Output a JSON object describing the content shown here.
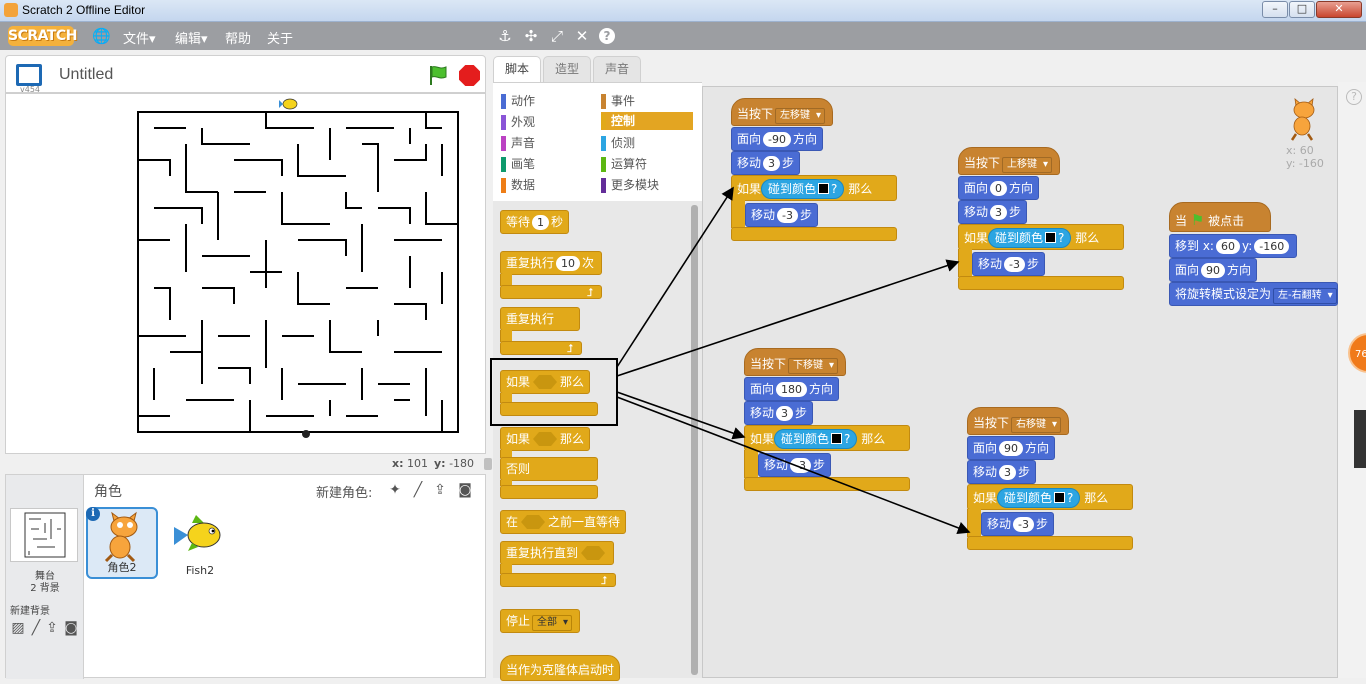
{
  "window": {
    "title": "Scratch 2 Offline Editor",
    "buttons": [
      "–",
      "□",
      "✕"
    ]
  },
  "menubar": {
    "logo": "SCRATCH",
    "items": [
      "文件▾",
      "编辑▾",
      "帮助",
      "关于"
    ],
    "tools": [
      "stamp-icon",
      "cut-icon",
      "grow-icon",
      "shrink-icon",
      "help-icon"
    ]
  },
  "stage": {
    "version": "v454",
    "title": "Untitled",
    "x_label": "x:",
    "x_value": "101",
    "y_label": "y:",
    "y_value": "-180"
  },
  "sprites_pane": {
    "title": "角色",
    "new_sprite": "新建角色:",
    "stage_name": "舞台",
    "stage_bg_count": "2 背景",
    "new_backdrop": "新建背景",
    "sprites": [
      {
        "name": "角色2",
        "selected": true
      },
      {
        "name": "Fish2",
        "selected": false
      }
    ]
  },
  "tabs": [
    "脚本",
    "造型",
    "声音"
  ],
  "categories": {
    "left": [
      {
        "label": "动作",
        "color": "#4a6cd4"
      },
      {
        "label": "外观",
        "color": "#8a55d7"
      },
      {
        "label": "声音",
        "color": "#bb42c3"
      },
      {
        "label": "画笔",
        "color": "#0e9a6c"
      },
      {
        "label": "数据",
        "color": "#ee7d16"
      }
    ],
    "right": [
      {
        "label": "事件",
        "color": "#c88330"
      },
      {
        "label": "控制",
        "color": "#e1a91a",
        "selected": true
      },
      {
        "label": "侦测",
        "color": "#2ca5e2"
      },
      {
        "label": "运算符",
        "color": "#5cb712"
      },
      {
        "label": "更多模块",
        "color": "#632d99"
      }
    ]
  },
  "palette": {
    "wait": "等待",
    "wait_val": "1",
    "wait_unit": "秒",
    "repeat": "重复执行",
    "repeat_val": "10",
    "repeat_unit": "次",
    "forever": "重复执行",
    "if": "如果",
    "then": "那么",
    "if2": "如果",
    "then2": "那么",
    "else": "否则",
    "wait_until_a": "在",
    "wait_until_b": "之前一直等待",
    "repeat_until": "重复执行直到",
    "stop": "停止",
    "stop_opt": "全部",
    "clone_start": "当作为克隆体启动时"
  },
  "scripts": {
    "s1": {
      "hat": "当按下",
      "key": "左移键",
      "point": "面向",
      "dir": "-90",
      "dir_unit": "方向",
      "move": "移动",
      "steps": "3",
      "step_unit": "步",
      "if": "如果",
      "touch": "碰到颜色",
      "q": "?",
      "then": "那么",
      "move2": "移动",
      "steps2": "-3",
      "step_unit2": "步"
    },
    "s2": {
      "hat": "当按下",
      "key": "上移键",
      "point": "面向",
      "dir": "0",
      "dir_unit": "方向",
      "move": "移动",
      "steps": "3",
      "step_unit": "步",
      "if": "如果",
      "touch": "碰到颜色",
      "q": "?",
      "then": "那么",
      "move2": "移动",
      "steps2": "-3",
      "step_unit2": "步"
    },
    "s3": {
      "hat": "当按下",
      "key": "下移键",
      "point": "面向",
      "dir": "180",
      "dir_unit": "方向",
      "move": "移动",
      "steps": "3",
      "step_unit": "步",
      "if": "如果",
      "touch": "碰到颜色",
      "q": "?",
      "then": "那么",
      "move2": "移动",
      "steps2": "-3",
      "step_unit2": "步"
    },
    "s4": {
      "hat": "当按下",
      "key": "右移键",
      "point": "面向",
      "dir": "90",
      "dir_unit": "方向",
      "move": "移动",
      "steps": "3",
      "step_unit": "步",
      "if": "如果",
      "touch": "碰到颜色",
      "q": "?",
      "then": "那么",
      "move2": "移动",
      "steps2": "-3",
      "step_unit2": "步"
    },
    "s5": {
      "hat_a": "当",
      "hat_b": "被点击",
      "goto": "移到 x:",
      "gx": "60",
      "gy_label": "y:",
      "gy": "-160",
      "point": "面向",
      "dir": "90",
      "dir_unit": "方向",
      "rot": "将旋转模式设定为",
      "rot_opt": "左-右翻转"
    }
  },
  "sprite_info": {
    "x": "x: 60",
    "y": "y: -160"
  },
  "badge": "76",
  "help": "?"
}
